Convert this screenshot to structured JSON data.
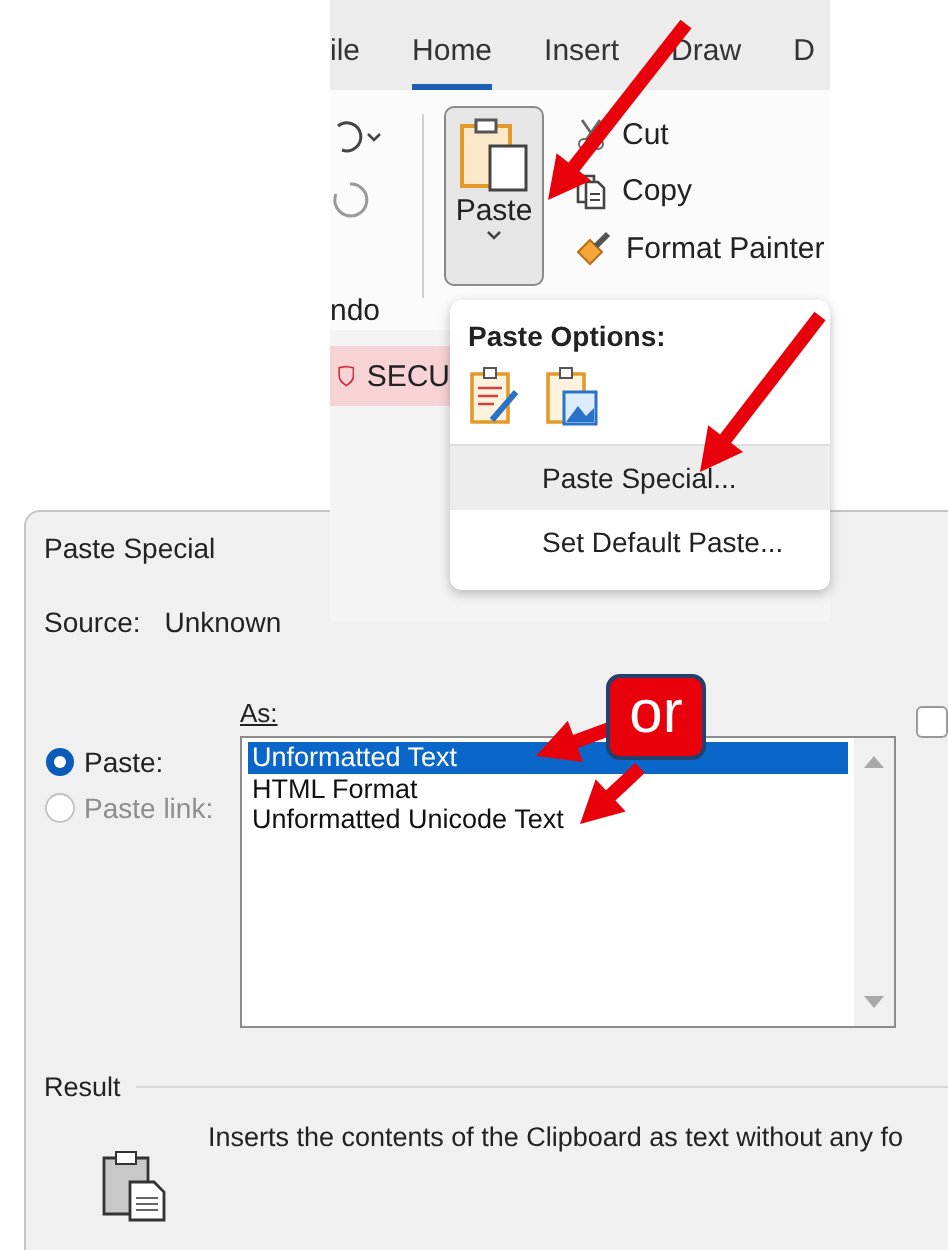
{
  "ribbon": {
    "tabs": [
      {
        "label": "ile",
        "selected": false
      },
      {
        "label": "Home",
        "selected": true
      },
      {
        "label": "Insert",
        "selected": false
      },
      {
        "label": "Draw",
        "selected": false
      },
      {
        "label": "D",
        "selected": false
      }
    ],
    "undo_group_label": "ndo",
    "paste_button": {
      "label": "Paste"
    },
    "clipboard_commands": [
      {
        "kind": "cut",
        "label": "Cut"
      },
      {
        "kind": "copy",
        "label": "Copy"
      },
      {
        "kind": "format-painter",
        "label": "Format Painter"
      }
    ],
    "security_bar": {
      "text": "SECU"
    }
  },
  "paste_menu": {
    "heading": "Paste Options:",
    "items": [
      {
        "label": "Paste Special...",
        "selected": true
      },
      {
        "label": "Set Default Paste...",
        "selected": false
      }
    ]
  },
  "dialog": {
    "title": "Paste Special",
    "source_label": "Source:",
    "source_value": "Unknown",
    "as_label": "As:",
    "radios": [
      {
        "label": "Paste:",
        "selected": true,
        "disabled": false
      },
      {
        "label": "Paste link:",
        "selected": false,
        "disabled": true
      }
    ],
    "formats": [
      {
        "label": "Unformatted Text",
        "selected": true
      },
      {
        "label": "HTML Format",
        "selected": false
      },
      {
        "label": "Unformatted Unicode Text",
        "selected": false
      }
    ],
    "checkbox": {
      "checked": false
    },
    "result_label": "Result",
    "result_text": "Inserts the contents of the Clipboard as text without any fo"
  },
  "annotations": {
    "callout": "or"
  }
}
